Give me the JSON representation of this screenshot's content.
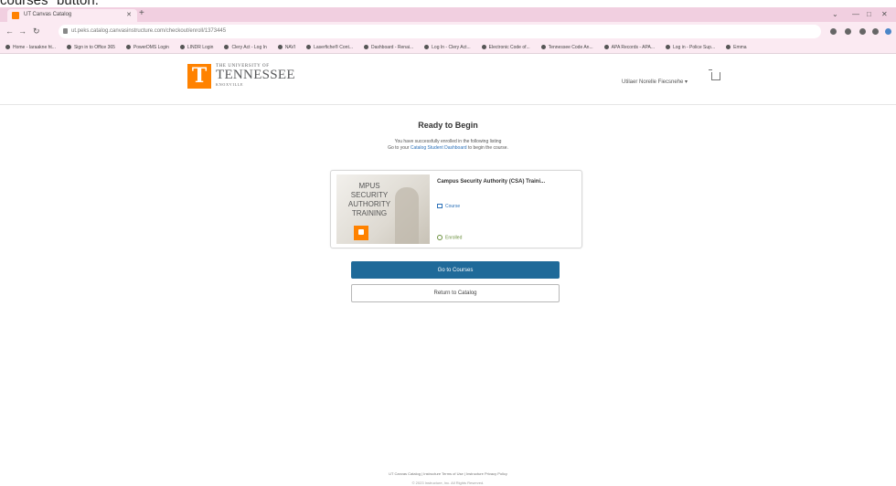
{
  "caption": "courses\" button.",
  "browser": {
    "tab_title": "UT Canvas Catalog",
    "url": "ut.peks.catalog.canvasinstructure.com/checkout/enroll/1373445",
    "new_tab": "+",
    "bookmarks": [
      "Home - Iaraakne ht...",
      "Sign in to Office 365",
      "PowerDMS Login",
      "LINDR Login",
      "Clery Act - Log In",
      "NAVI",
      "Laserfiche® Cont...",
      "Dashboard - Renai...",
      "Log In - Clery Act...",
      "Electronic Code of...",
      "Tennessee Code An...",
      "APA Records - APA...",
      "Log in - Police Sup...",
      "Emma"
    ]
  },
  "header": {
    "logo_letter": "T",
    "logo_line1": "THE UNIVERSITY OF",
    "logo_line2": "TENNESSEE",
    "logo_line3": "KNOXVILLE",
    "user_menu": "Utilaer Norelle Fiecsnehe ▾"
  },
  "main": {
    "title": "Ready to Begin",
    "subtitle_line1": "You have successfully enrolled in the following listing",
    "subtitle_pre": "Go to your",
    "subtitle_link": "Catalog Student Dashboard",
    "subtitle_post": "to begin the course."
  },
  "card": {
    "thumb_text": "MPUS SECURITY AUTHORITY TRAINING",
    "course_title": "Campus Security Authority (CSA) Traini...",
    "course_type": "Course",
    "status": "Enrolled"
  },
  "buttons": {
    "go_to_courses": "Go to Courses",
    "return_to_catalog": "Return to Catalog"
  },
  "footer": {
    "links": "UT Canvas Catalog  |  Instructure Terms of Use  |  Instructure Privacy Policy",
    "copyright": "© 2023 Instructure, Inc. All Rights Reserved."
  }
}
